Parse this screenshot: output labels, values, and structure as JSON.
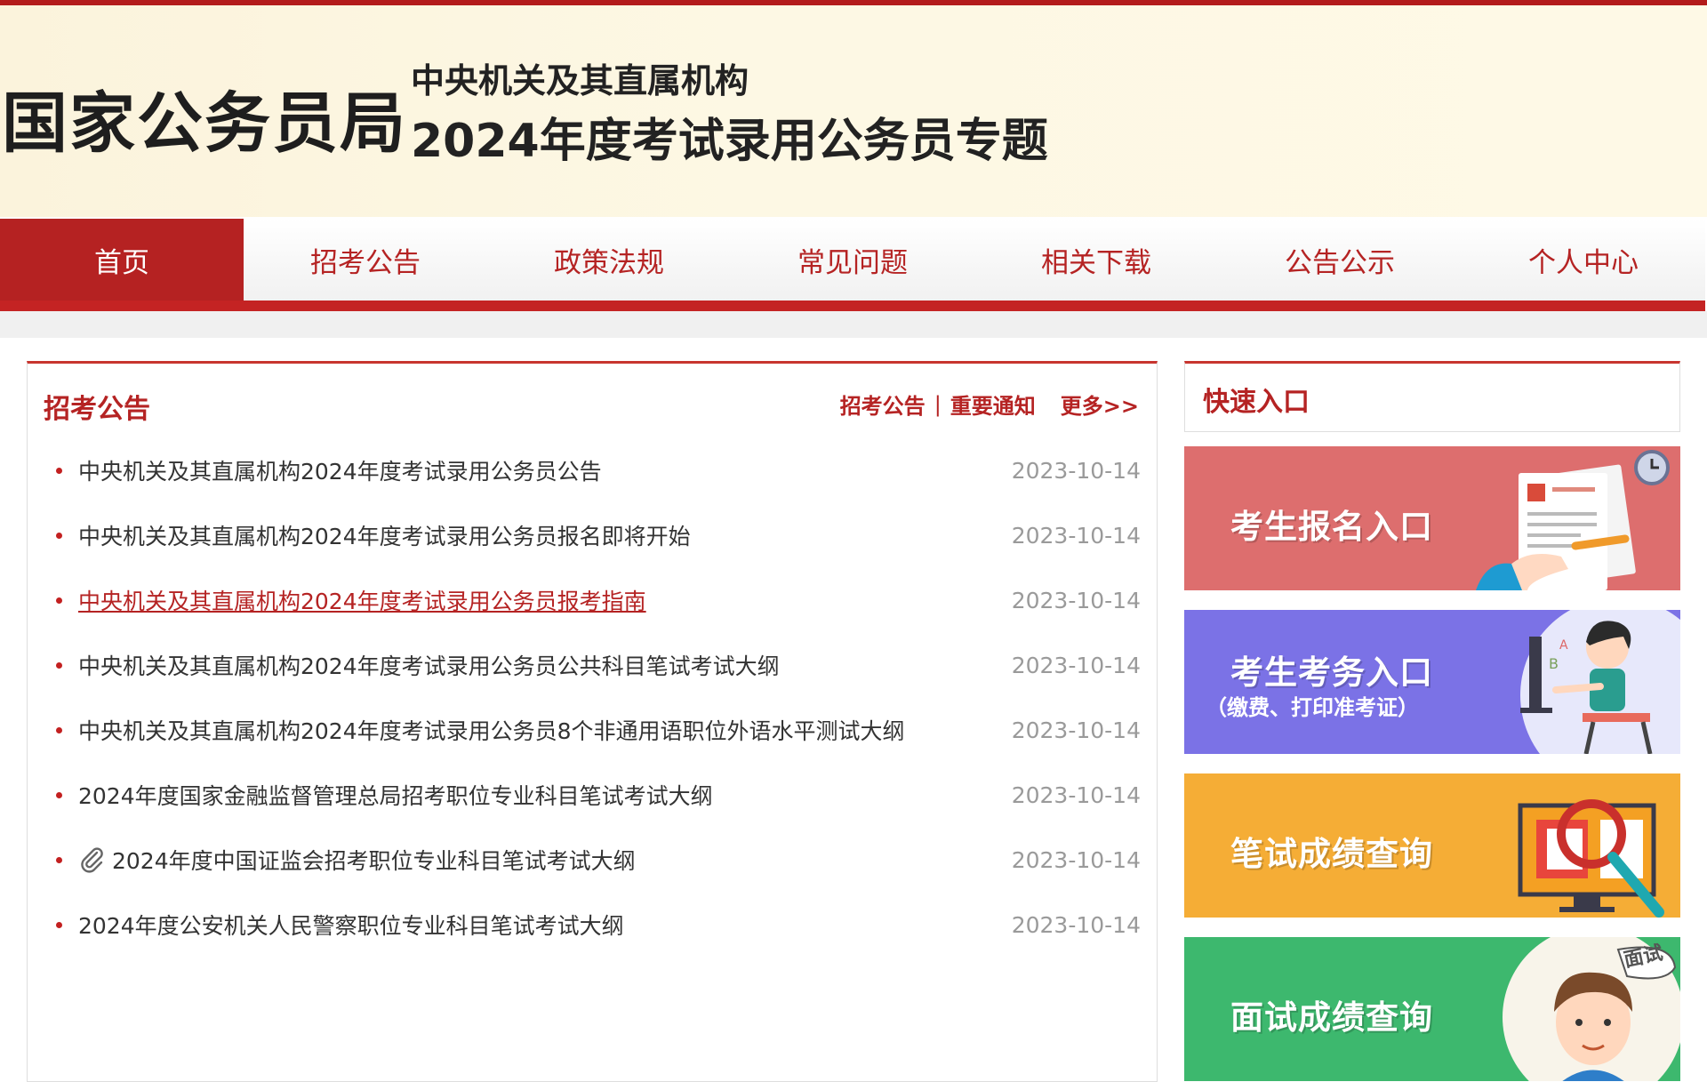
{
  "header": {
    "brand": "国家公务员局",
    "subtitle_line1": "中央机关及其直属机构",
    "subtitle_line2": "2024年度考试录用公务员专题"
  },
  "nav": {
    "items": [
      {
        "label": "首页",
        "active": true
      },
      {
        "label": "招考公告"
      },
      {
        "label": "政策法规"
      },
      {
        "label": "常见问题"
      },
      {
        "label": "相关下载"
      },
      {
        "label": "公告公示"
      },
      {
        "label": "个人中心"
      }
    ]
  },
  "announcements": {
    "title": "招考公告",
    "tab_links": [
      "招考公告",
      "重要通知"
    ],
    "separator": "|",
    "more": "更多>>",
    "items": [
      {
        "title": "中央机关及其直属机构2024年度考试录用公务员公告",
        "date": "2023-10-14"
      },
      {
        "title": "中央机关及其直属机构2024年度考试录用公务员报名即将开始",
        "date": "2023-10-14"
      },
      {
        "title": "中央机关及其直属机构2024年度考试录用公务员报考指南",
        "date": "2023-10-14",
        "highlighted": true
      },
      {
        "title": "中央机关及其直属机构2024年度考试录用公务员公共科目笔试考试大纲",
        "date": "2023-10-14"
      },
      {
        "title": "中央机关及其直属机构2024年度考试录用公务员8个非通用语职位外语水平测试大纲",
        "date": "2023-10-14"
      },
      {
        "title": "2024年度国家金融监督管理总局招考职位专业科目笔试考试大纲",
        "date": "2023-10-14"
      },
      {
        "title": "2024年度中国证监会招考职位专业科目笔试考试大纲",
        "date": "2023-10-14",
        "icon": "paperclip-icon"
      },
      {
        "title": "2024年度公安机关人民警察职位专业科目笔试考试大纲",
        "date": "2023-10-14"
      }
    ]
  },
  "quick_entry": {
    "title": "快速入口",
    "buttons": [
      {
        "label": "考生报名入口",
        "color": "#dd6e6e",
        "icon": "registration-form-icon"
      },
      {
        "label": "考生考务入口",
        "sublabel": "（缴费、打印准考证）",
        "color": "#7b72e6",
        "icon": "student-at-computer-icon"
      },
      {
        "label": "笔试成绩查询",
        "color": "#f5ad36",
        "icon": "monitor-magnifier-icon"
      },
      {
        "label": "面试成绩查询",
        "color": "#3db86e",
        "icon": "interview-person-icon",
        "badge": "面试"
      }
    ]
  },
  "colors": {
    "primary": "#b52323",
    "header_bg": "#fdf8e4",
    "date_gray": "#9a9a9a"
  }
}
